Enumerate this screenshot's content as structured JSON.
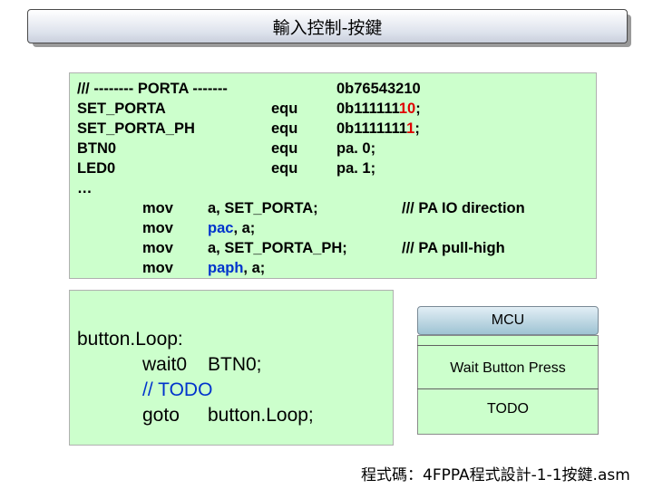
{
  "slide_title": "輸入控制-按鍵",
  "defs": {
    "header_comment": "/// -------- PORTA -------",
    "header_value": "0b76543210",
    "rows": [
      {
        "name": "SET_PORTA",
        "op": "equ",
        "value_a": "0b111111",
        "value_b": "10",
        "value_c": ";"
      },
      {
        "name": "SET_PORTA_PH",
        "op": "equ",
        "value_a": "0b1111111",
        "value_b": "1",
        "value_c": ";"
      },
      {
        "name": "BTN0",
        "op": "equ",
        "value_a": "pa. 0;",
        "value_b": "",
        "value_c": ""
      },
      {
        "name": "LED0",
        "op": "equ",
        "value_a": "pa. 1;",
        "value_b": "",
        "value_c": ""
      }
    ],
    "ellipsis": "…",
    "instructions": [
      {
        "op": "mov",
        "arg_a": "a, SET_PORTA;",
        "arg_b": "",
        "comment": "/// PA IO direction"
      },
      {
        "op": "mov",
        "arg_a": "pac",
        "arg_b": ", a;",
        "comment": ""
      },
      {
        "op": "mov",
        "arg_a": "a, SET_PORTA_PH;",
        "arg_b": "",
        "comment": "/// PA pull-high"
      },
      {
        "op": "mov",
        "arg_a": "paph",
        "arg_b": ", a;",
        "comment": ""
      }
    ]
  },
  "loop": {
    "label": "button.Loop:",
    "line1_op": "wait0",
    "line1_arg": "BTN0;",
    "todo": "// TODO",
    "line3_op": "goto",
    "line3_arg": "button.Loop;"
  },
  "mcu": {
    "header": "MCU",
    "step1": "Wait Button Press",
    "step2": "TODO"
  },
  "footer": "程式碼：4FPPA程式設計-1-1按鍵.asm",
  "colors": {
    "box": "#ccffcc",
    "highlight_red": "#e00000",
    "keyword_blue": "#0033cc"
  }
}
